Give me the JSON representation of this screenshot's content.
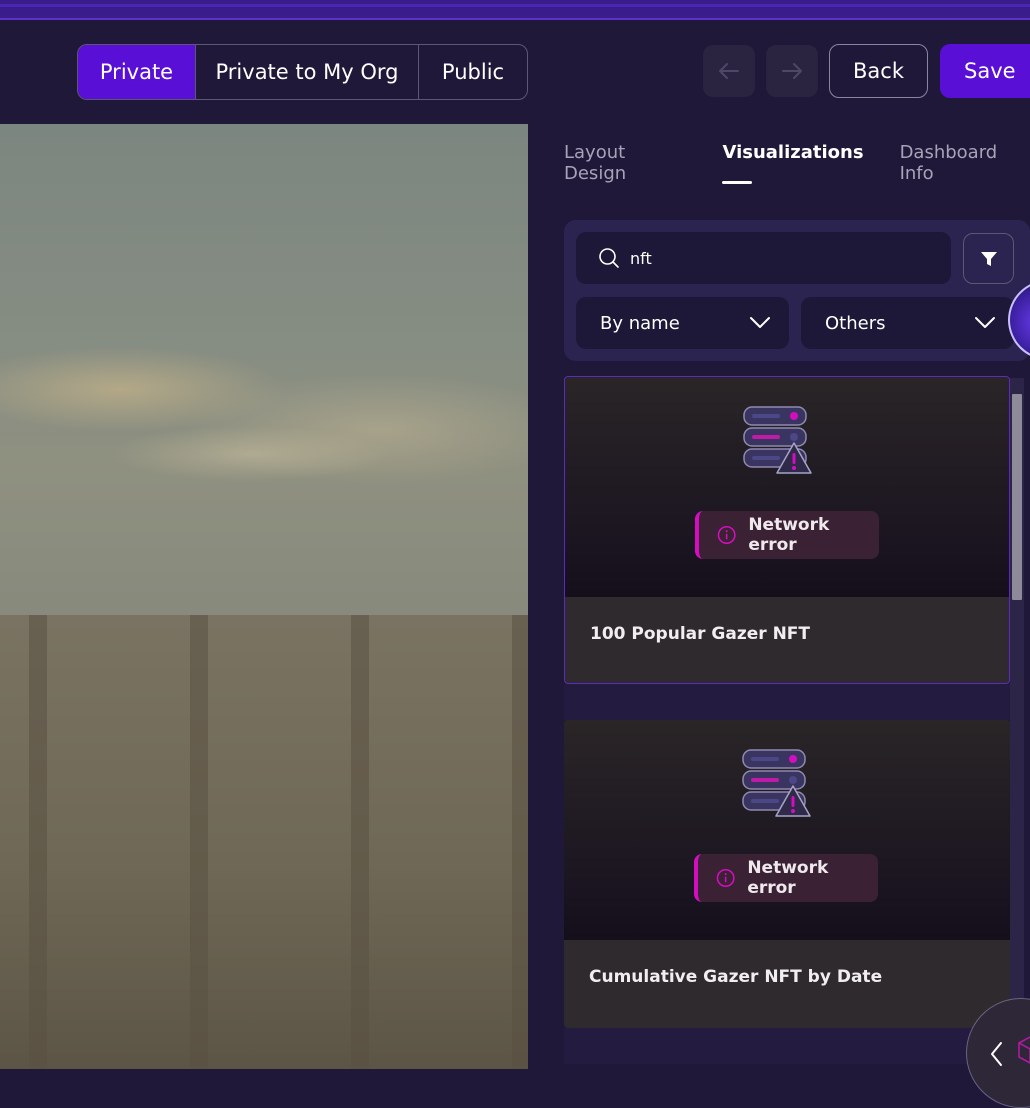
{
  "visibility": {
    "options": [
      {
        "label": "Private",
        "active": true
      },
      {
        "label": "Private to My Org",
        "active": false
      },
      {
        "label": "Public",
        "active": false
      }
    ]
  },
  "toolbar": {
    "undo_icon": "arrow-left-icon",
    "redo_icon": "arrow-right-icon",
    "back_label": "Back",
    "save_label": "Save"
  },
  "panel": {
    "tabs": [
      {
        "label": "Layout Design",
        "active": false
      },
      {
        "label": "Visualizations",
        "active": true
      },
      {
        "label": "Dashboard Info",
        "active": false
      }
    ],
    "search": {
      "value": "nft"
    },
    "sort_select": {
      "value": "By name"
    },
    "category_select": {
      "value": "Others"
    }
  },
  "cards": [
    {
      "title": "100 Popular Gazer NFT",
      "error": "Network error",
      "selected": true
    },
    {
      "title": "Cumulative Gazer NFT by Date",
      "error": "Network error",
      "selected": false
    }
  ],
  "colors": {
    "accent": "#5a0fd6",
    "error": "#d40ec0",
    "background": "#1f1838"
  }
}
